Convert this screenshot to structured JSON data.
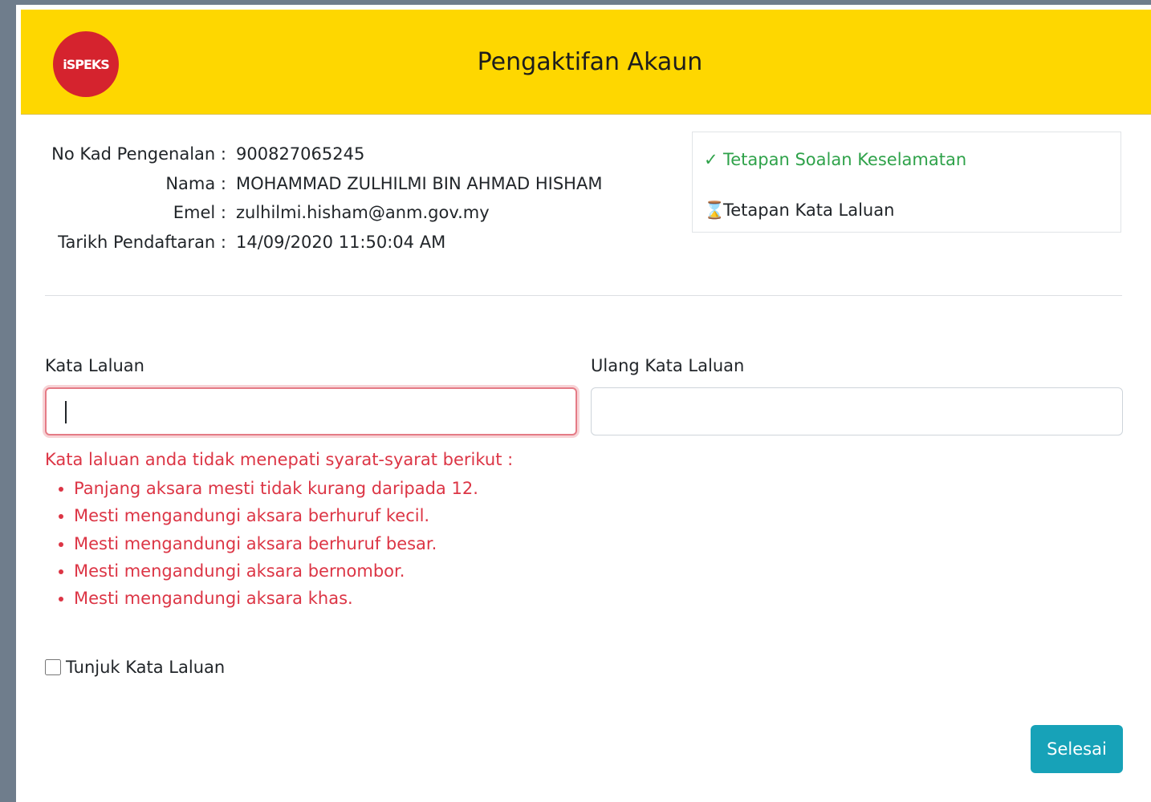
{
  "header": {
    "logo_text": "iSPEKS",
    "title": "Pengaktifan Akaun"
  },
  "account": {
    "rows": [
      {
        "label": "No Kad Pengenalan :",
        "value": "900827065245"
      },
      {
        "label": "Nama :",
        "value": "MOHAMMAD ZULHILMI BIN AHMAD HISHAM"
      },
      {
        "label": "Emel :",
        "value": "zulhilmi.hisham@anm.gov.my"
      },
      {
        "label": "Tarikh Pendaftaran :",
        "value": "14/09/2020 11:50:04 AM"
      }
    ]
  },
  "steps": {
    "step1": {
      "icon": "check-icon",
      "mark": "✓",
      "label": "Tetapan Soalan Keselamatan",
      "color": "#2fa24a"
    },
    "step2": {
      "icon": "hourglass-icon",
      "mark": "⌛",
      "label": "Tetapan Kata Laluan"
    }
  },
  "form": {
    "password_label": "Kata Laluan",
    "password_value": "",
    "confirm_label": "Ulang Kata Laluan",
    "confirm_value": "",
    "error_title": "Kata laluan anda tidak menepati syarat-syarat berikut :",
    "errors": [
      "Panjang aksara mesti tidak kurang daripada 12.",
      "Mesti mengandungi aksara berhuruf kecil.",
      "Mesti mengandungi aksara berhuruf besar.",
      "Mesti mengandungi aksara bernombor.",
      "Mesti mengandungi aksara khas."
    ],
    "show_password_label": "Tunjuk Kata Laluan",
    "show_password_checked": false,
    "submit_label": "Selesai"
  },
  "colors": {
    "header_bg": "#fed700",
    "logo_bg": "#d5232e",
    "error": "#dc3545",
    "success": "#2fa24a",
    "button": "#17a2b8"
  }
}
